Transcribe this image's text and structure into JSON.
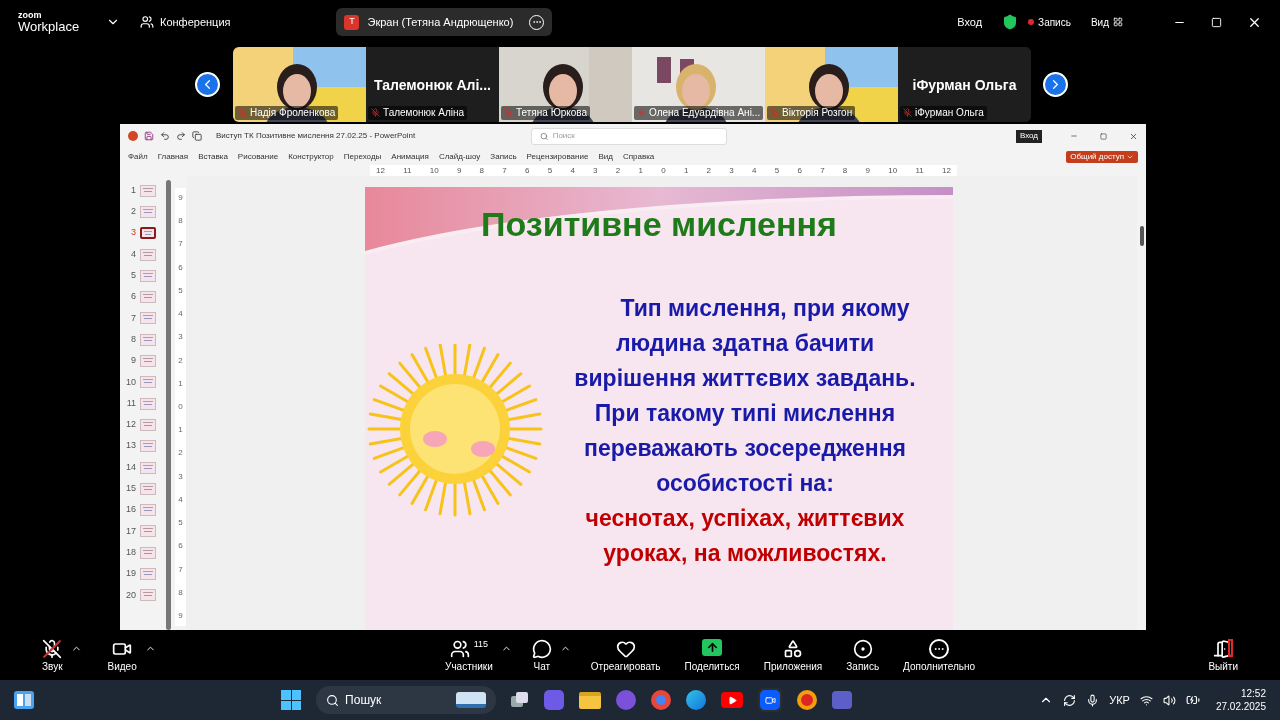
{
  "top_bar": {
    "logo_top": "zoom",
    "logo_bottom": "Workplace",
    "meeting": "Конференция",
    "share_pill": {
      "initial": "T",
      "label": "Экран (Тетяна Андрющенко)"
    },
    "sign_in": "Вход",
    "recording": "Запись",
    "view": "Вид"
  },
  "participants": [
    {
      "kind": "video",
      "name": "Надія Фроленкова",
      "muted": true
    },
    {
      "kind": "name",
      "display": "Талемонюк  Алі...",
      "name": "Талемонюк Аліна",
      "muted": true
    },
    {
      "kind": "video",
      "name": "Тетяна Юркова",
      "muted": true
    },
    {
      "kind": "video",
      "name": "Олена Едуардівна Ані...",
      "muted": true
    },
    {
      "kind": "video",
      "name": "Вікторія Розгон",
      "muted": true
    },
    {
      "kind": "name",
      "display": "іФурман Ольга",
      "name": "іФурман Ольга",
      "muted": true
    }
  ],
  "powerpoint": {
    "title": "Виступ ТК Позитивне мислення 27.02.25  -  PowerPoint",
    "search": {
      "placeholder": "Поиск"
    },
    "sign_in": "Вход",
    "menu": [
      "Файл",
      "Главная",
      "Вставка",
      "Рисование",
      "Конструктор",
      "Переходы",
      "Анимация",
      "Слайд-шоу",
      "Запись",
      "Рецензирование",
      "Вид",
      "Справка"
    ],
    "share": "Общий доступ",
    "ruler_h": [
      "12",
      "11",
      "10",
      "9",
      "8",
      "7",
      "6",
      "5",
      "4",
      "3",
      "2",
      "1",
      "0",
      "1",
      "2",
      "3",
      "4",
      "5",
      "6",
      "7",
      "8",
      "9",
      "10",
      "11",
      "12"
    ],
    "ruler_v": [
      "9",
      "8",
      "7",
      "6",
      "5",
      "4",
      "3",
      "2",
      "1",
      "0",
      "1",
      "2",
      "3",
      "4",
      "5",
      "6",
      "7",
      "8",
      "9"
    ],
    "thumbnails": [
      {
        "number": "1",
        "selected": false
      },
      {
        "number": "2",
        "selected": false
      },
      {
        "number": "3",
        "selected": true
      },
      {
        "number": "4",
        "selected": false
      },
      {
        "number": "5",
        "selected": false
      },
      {
        "number": "6",
        "selected": false
      },
      {
        "number": "7",
        "selected": false
      },
      {
        "number": "8",
        "selected": false
      },
      {
        "number": "9",
        "selected": false
      },
      {
        "number": "10",
        "selected": false
      },
      {
        "number": "11",
        "selected": false
      },
      {
        "number": "12",
        "selected": false
      },
      {
        "number": "13",
        "selected": false
      },
      {
        "number": "14",
        "selected": false
      },
      {
        "number": "15",
        "selected": false
      },
      {
        "number": "16",
        "selected": false
      },
      {
        "number": "17",
        "selected": false
      },
      {
        "number": "18",
        "selected": false
      },
      {
        "number": "19",
        "selected": false
      },
      {
        "number": "20",
        "selected": false
      }
    ],
    "slide": {
      "title": "Позитивне мислення",
      "lines": [
        {
          "text": "Тип мислення, при якому",
          "color": "#1a1aa8"
        },
        {
          "text": "людина здатна бачити",
          "color": "#1a1aa8"
        },
        {
          "text": "вирішення життєвих завдань.",
          "color": "#1a1aa8"
        },
        {
          "text": "При такому типі мислення",
          "color": "#1a1aa8"
        },
        {
          "text": "переважають зосередження",
          "color": "#1a1aa8"
        },
        {
          "text": "особистості на:",
          "color": "#1a1aa8"
        },
        {
          "text": "чеснотах, успіхах, життєвих",
          "color": "#c00000"
        },
        {
          "text": "уроках, на можливостях.",
          "color": "#c00000"
        }
      ]
    }
  },
  "toolbar": [
    {
      "kind": "mic",
      "label": "Звук",
      "caret": true
    },
    {
      "kind": "video",
      "label": "Видео",
      "caret": true
    },
    {
      "kind": "participants",
      "label": "Участники",
      "count": "115",
      "caret": true
    },
    {
      "kind": "chat",
      "label": "Чат",
      "caret": true
    },
    {
      "kind": "react",
      "label": "Отреагировать",
      "caret": false
    },
    {
      "kind": "share",
      "label": "Поделиться",
      "caret": false
    },
    {
      "kind": "apps",
      "label": "Приложения",
      "caret": false
    },
    {
      "kind": "record",
      "label": "Запись",
      "caret": false
    },
    {
      "kind": "more",
      "label": "Дополнительно",
      "caret": false
    },
    {
      "kind": "leave",
      "label": "Выйти",
      "caret": false
    }
  ],
  "taskbar": {
    "search": {
      "placeholder": "Пошук"
    },
    "language": "УКР",
    "time": "12:52",
    "date": "27.02.2025"
  }
}
